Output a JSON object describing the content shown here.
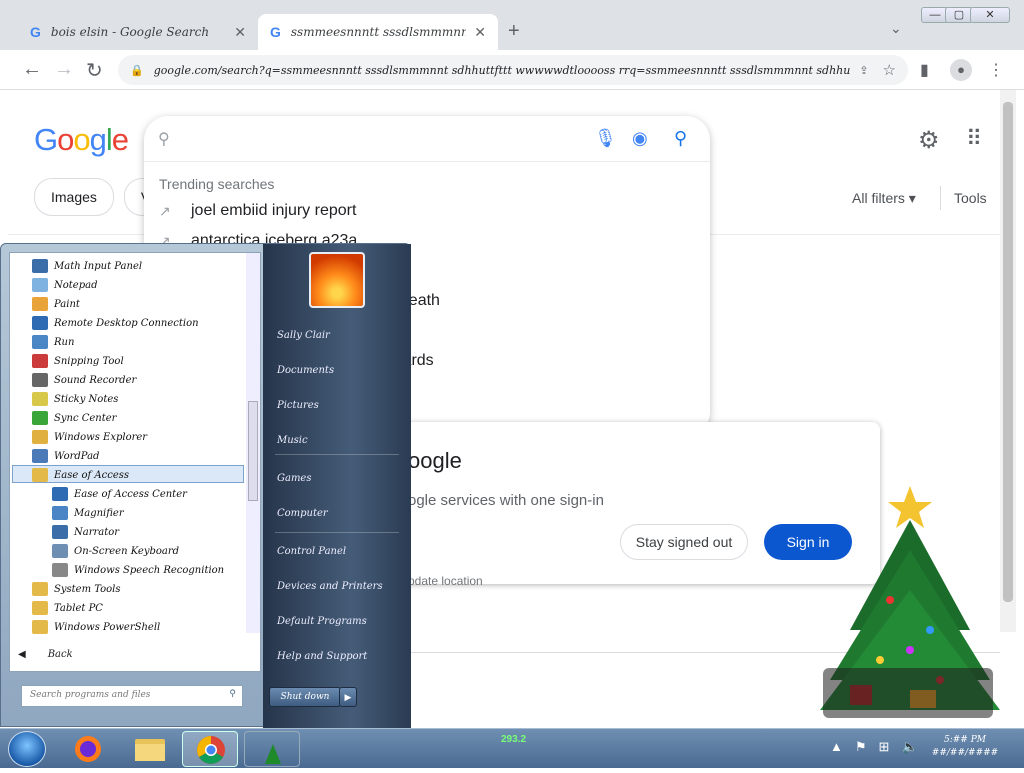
{
  "browser": {
    "tabs": [
      {
        "title": "bois elsin - Google Search",
        "close": "✕"
      },
      {
        "title": "ssmmeesnnntt sssdlsmmmnnt sdhhuttfttt wwwd",
        "close": "✕"
      }
    ],
    "new_tab": "+",
    "tab_menu": "⌄",
    "window_controls": {
      "minimize": "—",
      "maximize": "▢",
      "close": "✕"
    },
    "url": "google.com/search?q=ssmmeesnnntt sssdlsmmmnnt sdhhuttfttt wwwwwdtlooooss rrq=ssmmeesnnntt sssdlsmmmnnt sdhhuttfttt wwwdtlooooss oqs=chome.◆♥✦◆..◆.◆.◆..◆ ◆≠◆7≠/≠..",
    "nav": {
      "back": "←",
      "forward": "→",
      "reload": "↻"
    }
  },
  "google": {
    "logo_letters": [
      {
        "ch": "G",
        "color": "#4285F4"
      },
      {
        "ch": "o",
        "color": "#EA4335"
      },
      {
        "ch": "o",
        "color": "#FBBC05"
      },
      {
        "ch": "g",
        "color": "#4285F4"
      },
      {
        "ch": "l",
        "color": "#34A853"
      },
      {
        "ch": "e",
        "color": "#EA4335"
      }
    ],
    "chips": [
      "Images",
      "Vi"
    ],
    "all_filters": "All filters ▾",
    "tools": "Tools",
    "search_placeholder": "",
    "trending_header": "Trending searches",
    "trending": [
      "joel embiid injury report",
      "antarctica iceberg a23a",
      "",
      "t death",
      "",
      "wards"
    ],
    "signin_card": {
      "title": "oogle",
      "subtitle": "ogle services with one sign-in",
      "stay_out": "Stay signed out",
      "sign_in": "Sign in"
    },
    "update_location": "pdate location"
  },
  "start_menu": {
    "programs": [
      {
        "label": "Math Input Panel",
        "color": "#3b6ea8",
        "sub": false
      },
      {
        "label": "Notepad",
        "color": "#7fb2e0",
        "sub": false
      },
      {
        "label": "Paint",
        "color": "#e8a33b",
        "sub": false
      },
      {
        "label": "Remote Desktop Connection",
        "color": "#2f6bb3",
        "sub": false
      },
      {
        "label": "Run",
        "color": "#4a86c6",
        "sub": false
      },
      {
        "label": "Snipping Tool",
        "color": "#cc3b3b",
        "sub": false
      },
      {
        "label": "Sound Recorder",
        "color": "#666666",
        "sub": false
      },
      {
        "label": "Sticky Notes",
        "color": "#d8c84a",
        "sub": false
      },
      {
        "label": "Sync Center",
        "color": "#3aa63a",
        "sub": false
      },
      {
        "label": "Windows Explorer",
        "color": "#e0b040",
        "sub": false
      },
      {
        "label": "WordPad",
        "color": "#4a7ab8",
        "sub": false
      },
      {
        "label": "Ease of Access",
        "color": "#e3b94a",
        "sub": false
      },
      {
        "label": "Ease of Access Center",
        "color": "#2f6bb3",
        "sub": true
      },
      {
        "label": "Magnifier",
        "color": "#4a86c6",
        "sub": true
      },
      {
        "label": "Narrator",
        "color": "#3b6ea8",
        "sub": true
      },
      {
        "label": "On-Screen Keyboard",
        "color": "#6f8fb2",
        "sub": true
      },
      {
        "label": "Windows Speech Recognition",
        "color": "#888888",
        "sub": true
      },
      {
        "label": "System Tools",
        "color": "#e3b94a",
        "sub": false
      },
      {
        "label": "Tablet PC",
        "color": "#e3b94a",
        "sub": false
      },
      {
        "label": "Windows PowerShell",
        "color": "#e3b94a",
        "sub": false
      }
    ],
    "back": "Back",
    "search_placeholder": "Search programs and files",
    "right_items": [
      "Sally Clair",
      "Documents",
      "Pictures",
      "Music",
      "Games",
      "Computer",
      "Control Panel",
      "Devices and Printers",
      "Default Programs",
      "Help and Support"
    ],
    "shutdown": "Shut down"
  },
  "taskbar": {
    "mem_label": "293.2",
    "clock_time": "5:## PM",
    "clock_date": "##/##/####"
  }
}
